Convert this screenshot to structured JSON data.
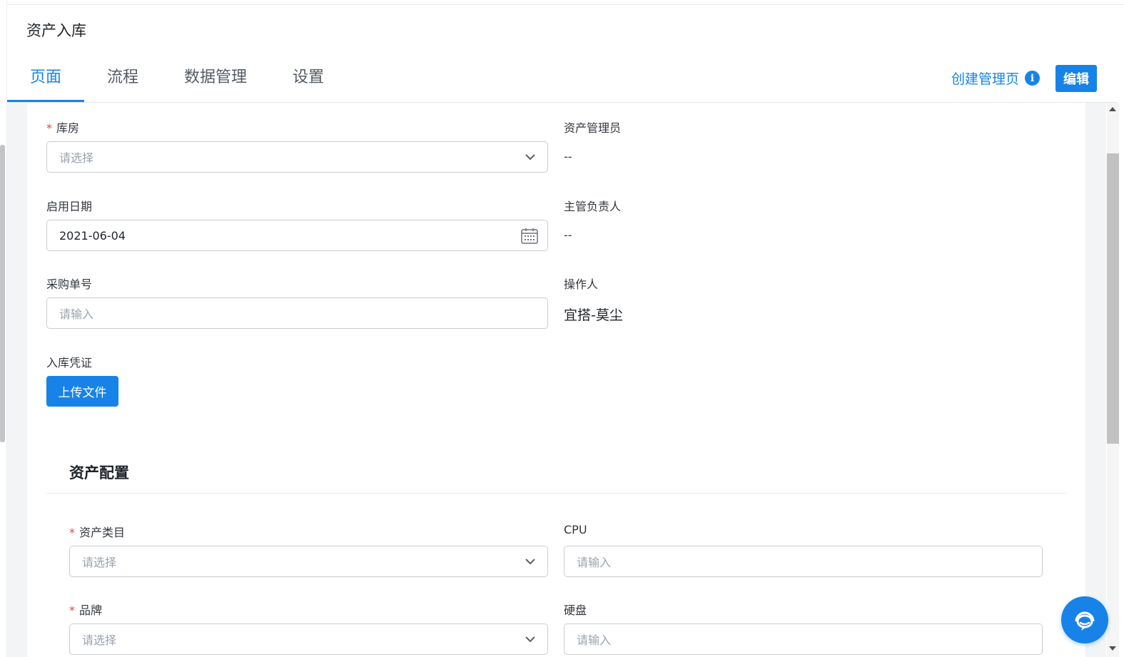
{
  "app": {
    "title": "资产入库"
  },
  "tabs": [
    {
      "label": "页面",
      "active": true
    },
    {
      "label": "流程",
      "active": false
    },
    {
      "label": "数据管理",
      "active": false
    },
    {
      "label": "设置",
      "active": false
    }
  ],
  "header_actions": {
    "create_link": "创建管理页",
    "create_link_icon": "info-icon",
    "edit_button": "编辑"
  },
  "form": {
    "warehouse": {
      "label": "库房",
      "required": true,
      "placeholder": "请选择"
    },
    "asset_admin": {
      "label": "资产管理员",
      "value": "--"
    },
    "start_date": {
      "label": "启用日期",
      "value": "2021-06-04"
    },
    "supervisor": {
      "label": "主管负责人",
      "value": "--"
    },
    "purchase_no": {
      "label": "采购单号",
      "placeholder": "请输入"
    },
    "operator": {
      "label": "操作人",
      "value": "宜搭-莫尘"
    },
    "voucher": {
      "label": "入库凭证",
      "button": "上传文件"
    }
  },
  "asset_config": {
    "title": "资产配置",
    "category": {
      "label": "资产类目",
      "required": true,
      "placeholder": "请选择"
    },
    "cpu": {
      "label": "CPU",
      "placeholder": "请输入"
    },
    "brand": {
      "label": "品牌",
      "required": true,
      "placeholder": "请选择"
    },
    "disk": {
      "label": "硬盘",
      "placeholder": "请输入"
    }
  },
  "colors": {
    "accent": "#1783e8",
    "required": "#e0443c",
    "border": "#c9ccd1",
    "placeholder": "#9aa3ad"
  }
}
